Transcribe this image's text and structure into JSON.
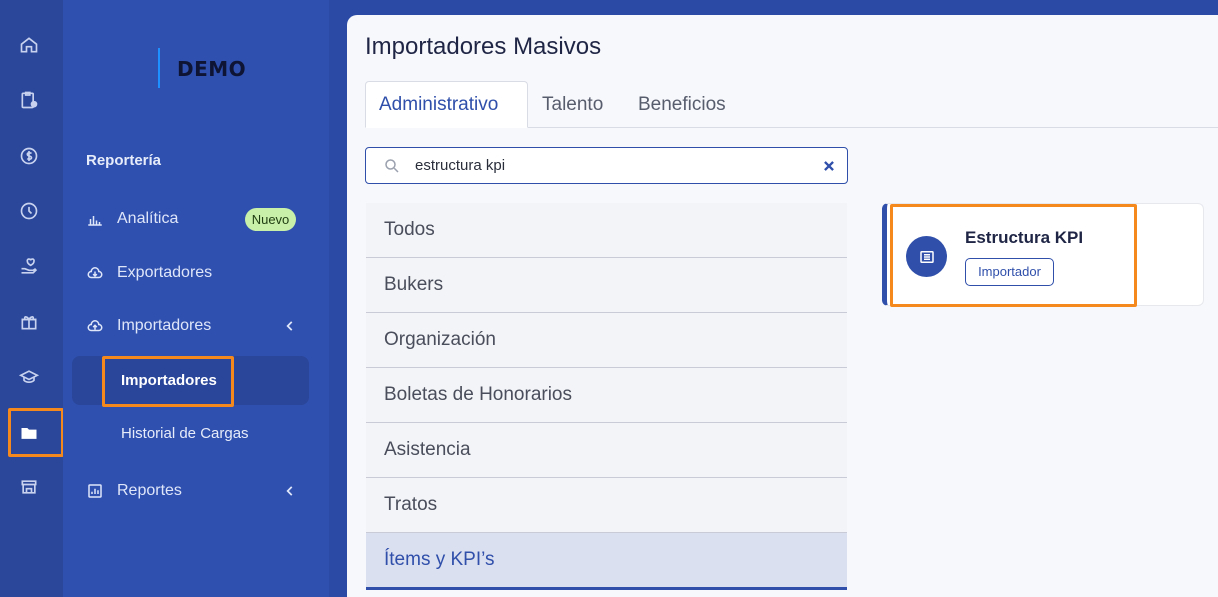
{
  "brand": {
    "logo_text": "DEMO"
  },
  "rail": {
    "icons": [
      "home-icon",
      "clipboard-clock-icon",
      "dollar-icon",
      "clock-icon",
      "hand-heart-icon",
      "gift-icon",
      "graduation-cap-icon",
      "folder-icon",
      "store-icon"
    ],
    "active_icon": "folder-icon"
  },
  "sidebar": {
    "section_title": "Reportería",
    "items": [
      {
        "label": "Analítica",
        "icon": "bar-chart-icon",
        "badge": "Nuevo"
      },
      {
        "label": "Exportadores",
        "icon": "cloud-download-icon"
      },
      {
        "label": "Importadores",
        "icon": "cloud-upload-icon",
        "expanded": true
      },
      {
        "label": "Reportes",
        "icon": "report-icon"
      }
    ],
    "subitems": [
      {
        "label": "Importadores",
        "active": true
      },
      {
        "label": "Historial de Cargas"
      }
    ]
  },
  "main": {
    "title": "Importadores Masivos",
    "tabs": [
      {
        "label": "Administrativo",
        "active": true
      },
      {
        "label": "Talento"
      },
      {
        "label": "Beneficios"
      }
    ],
    "search": {
      "value": "estructura kpi"
    },
    "categories": [
      {
        "label": "Todos"
      },
      {
        "label": "Bukers"
      },
      {
        "label": "Organización"
      },
      {
        "label": "Boletas de Honorarios"
      },
      {
        "label": "Asistencia"
      },
      {
        "label": "Tratos"
      },
      {
        "label": "Ítems y KPI’s",
        "active": true
      }
    ],
    "result_card": {
      "title": "Estructura KPI",
      "tag": "Importador",
      "icon": "list-icon"
    }
  },
  "colors": {
    "primary": "#2f4faa",
    "sidebar": "#2f50ae",
    "rail": "#2a4799",
    "highlight": "#f5891e",
    "badge": "#c8f0a8"
  }
}
